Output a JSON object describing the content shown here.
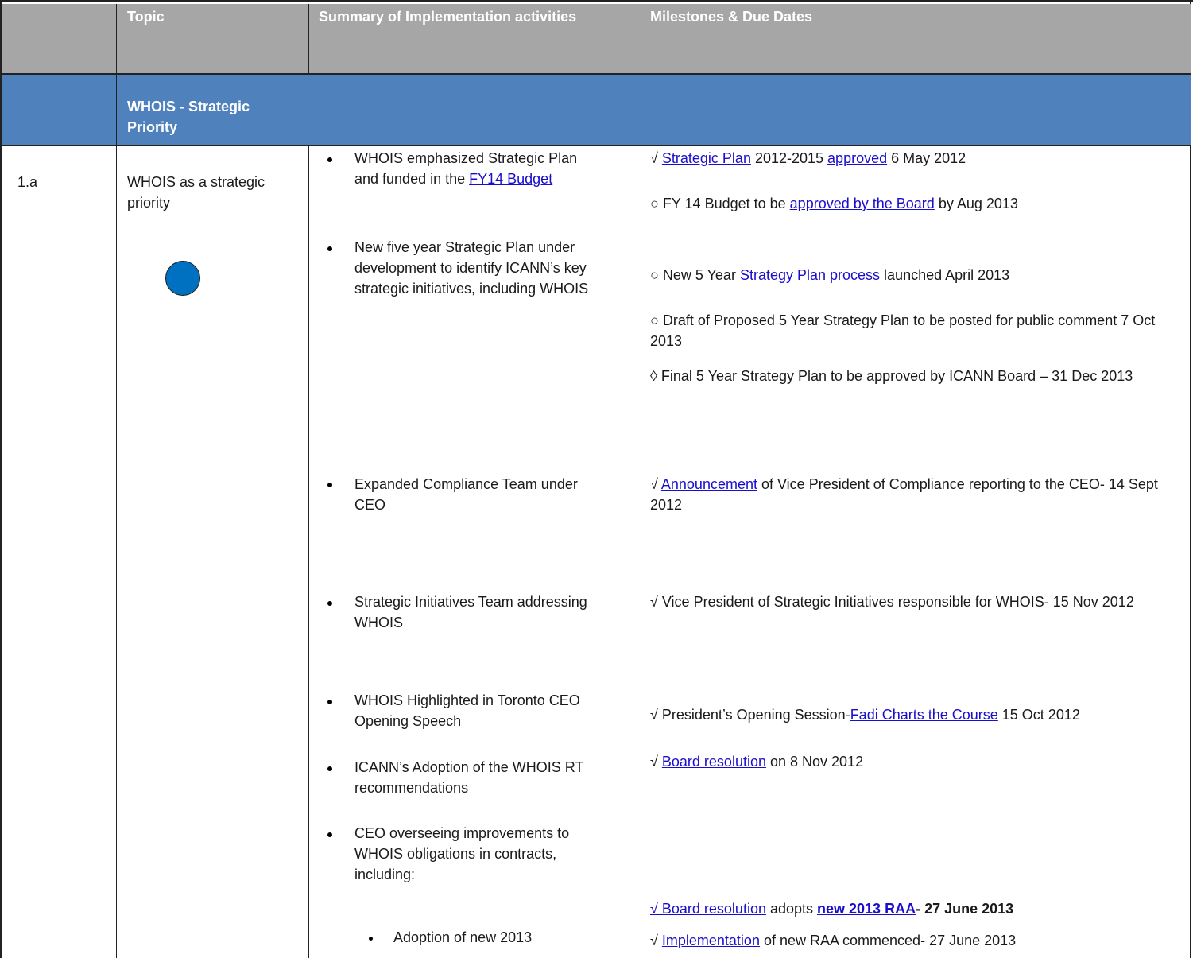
{
  "header": {
    "col_topic": "Topic",
    "col_summary": "Summary of Implementation activities",
    "col_milestones": "Milestones & Due Dates"
  },
  "section": {
    "title": "WHOIS  - Strategic Priority"
  },
  "row": {
    "id": "1.a",
    "topic": "WHOIS as a strategic priority",
    "status_color": "#0070c0"
  },
  "activities": [
    {
      "pre": "WHOIS emphasized  Strategic Plan and funded in the ",
      "link": "FY14 Budget",
      "post": ""
    },
    {
      "pre": "New five year Strategic Plan under development  to identify ICANN’s key strategic initiatives, including WHOIS",
      "link": "",
      "post": ""
    },
    {
      "pre": "Expanded Compliance Team under CEO",
      "link": "",
      "post": ""
    },
    {
      "pre": "Strategic Initiatives Team addressing WHOIS",
      "link": "",
      "post": ""
    },
    {
      "pre": "WHOIS Highlighted in Toronto CEO Opening Speech",
      "link": "",
      "post": ""
    },
    {
      "pre": "ICANN’s Adoption of the WHOIS RT recommendations",
      "link": "",
      "post": ""
    },
    {
      "pre": "CEO overseeing improvements to WHOIS obligations in contracts, including:",
      "link": "",
      "post": ""
    }
  ],
  "sub_activity": "Adoption of  new 2013",
  "milestones": {
    "m1": {
      "mark": "√ ",
      "link1": "Strategic Plan",
      "mid": " 2012-2015 ",
      "link2": "approved",
      "post": " 6 May 2012"
    },
    "m2": {
      "mark": "○ FY 14 Budget to be ",
      "link": "approved by the Board",
      "post": "  by Aug 2013"
    },
    "m3": {
      "mark": "○ New 5 Year ",
      "link": "Strategy Plan process",
      "post": " launched April 2013"
    },
    "m4": {
      "text": "○ Draft of Proposed 5 Year Strategy Plan to be posted for public comment 7 Oct 2013"
    },
    "m5": {
      "text": "◊ Final 5 Year Strategy Plan to be approved by ICANN Board – 31 Dec 2013"
    },
    "m6": {
      "mark": "√ ",
      "link": "Announcement",
      "post": " of Vice President of Compliance reporting to the CEO-  14 Sept 2012"
    },
    "m7": {
      "text": "√ Vice President of Strategic Initiatives responsible for WHOIS- 15 Nov 2012"
    },
    "m8": {
      "mark": "√ President’s Opening Session-",
      "link": "Fadi Charts the Course",
      "post": " 15 Oct 2012"
    },
    "m9": {
      "mark": "√ ",
      "link": "Board resolution",
      "post": " on 8 Nov 2012"
    },
    "m10": {
      "link": "√ Board resolution",
      "mid": " adopts ",
      "link2": "new 2013 RAA",
      "post": "-  27 June 2013"
    },
    "m11": {
      "mark": "√ ",
      "link": "Implementation",
      "post": " of new RAA commenced- 27 June 2013"
    }
  }
}
